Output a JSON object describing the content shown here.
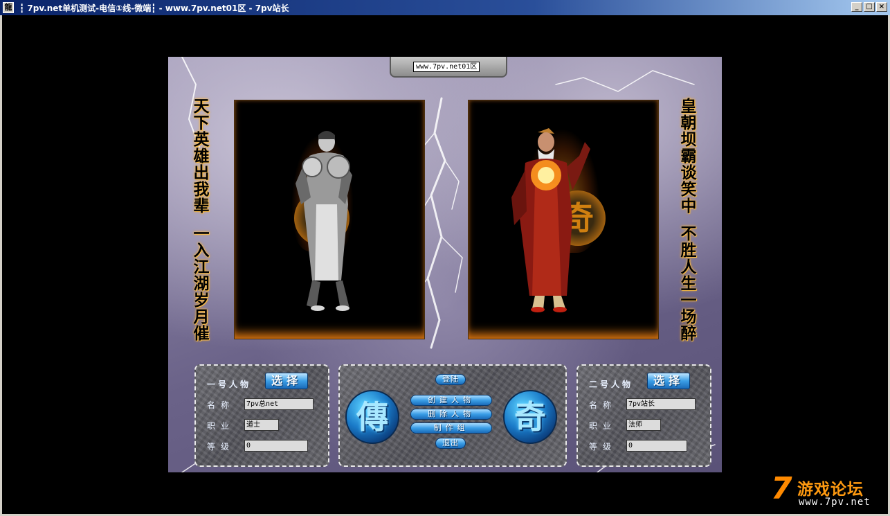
{
  "window": {
    "icon": "龍",
    "title": "┇ 7pv.net单机测试-电信①线-微端┇ - www.7pv.net01区 - 7pv站长",
    "minimize": "_",
    "maximize": "□",
    "close": "×"
  },
  "server": {
    "name": "www.7pv.net01区"
  },
  "poems": {
    "left": [
      "天",
      "下",
      "英",
      "雄",
      "出",
      "我",
      "辈",
      "",
      "一",
      "入",
      "江",
      "湖",
      "岁",
      "月",
      "催"
    ],
    "right": [
      "皇",
      "朝",
      "坝",
      "霸",
      "谈",
      "笑",
      "中",
      "",
      "不",
      "胜",
      "人",
      "生",
      "一",
      "场",
      "醉"
    ]
  },
  "emblems": {
    "character1": "传",
    "character2": "奇"
  },
  "slot1": {
    "title": "一号人物",
    "select_label": "选择",
    "name_label": "名称",
    "name_value": "7pv总net",
    "class_label": "职业",
    "class_value": "道士",
    "level_label": "等级",
    "level_value": "0"
  },
  "slot2": {
    "title": "二号人物",
    "select_label": "选择",
    "name_label": "名称",
    "name_value": "7pv站长",
    "class_label": "职业",
    "class_value": "法师",
    "level_label": "等级",
    "level_value": "0"
  },
  "center": {
    "glyph_left": "傳",
    "glyph_right": "奇",
    "login": "登陆",
    "create": "创建人物",
    "delete": "删除人物",
    "credits": "制作组",
    "exit": "退出"
  },
  "watermark": {
    "seven": "7",
    "title": "游戏论坛",
    "url": "www.7pv.net"
  },
  "colors": {
    "accent_blue": "#3a9ee6",
    "flame": "#f0a020",
    "titlebar": "#0a246a"
  }
}
